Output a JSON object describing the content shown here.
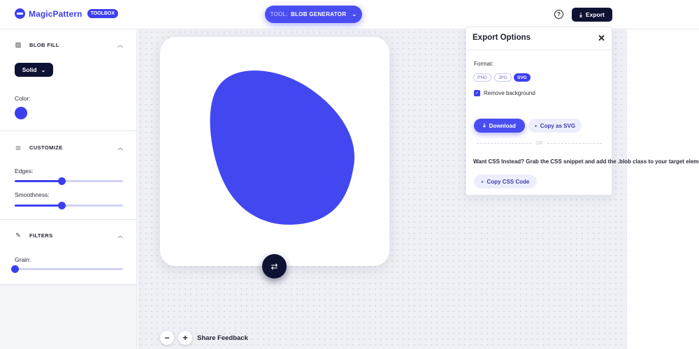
{
  "header": {
    "brand": "MagicPattern",
    "badge": "TOOLBOX",
    "tool_prefix": "TOOL:",
    "tool_name": "BLOB GENERATOR",
    "help_glyph": "?",
    "export_label": "Export"
  },
  "sidebar": {
    "blob_fill": {
      "title": "BLOB FILL",
      "fill_type": "Solid",
      "color_label": "Color:",
      "color": "#3c3ff0"
    },
    "customize": {
      "title": "CUSTOMIZE",
      "edges_label": "Edges:",
      "edges_value": 0.43,
      "smoothness_label": "Smoothness:",
      "smoothness_value": 0.43
    },
    "filters": {
      "title": "FILTERS",
      "grain_label": "Grain:",
      "grain_value": 0.0
    }
  },
  "canvas": {
    "blob_color": "#4347f0",
    "feedback_label": "Share Feedback",
    "zoom_out": "−",
    "zoom_in": "+"
  },
  "export_panel": {
    "title": "Export Options",
    "format_label": "Format:",
    "formats": [
      "PNG",
      "JPG",
      "SVG"
    ],
    "selected_format": "SVG",
    "remove_bg_label": "Remove background",
    "remove_bg_checked": true,
    "download_label": "Download",
    "copy_svg_label": "Copy as SVG",
    "or_label": "OR",
    "css_hint": "Want CSS Instead? Grab the CSS snippet and add the .blob class to your target element",
    "copy_css_label": "Copy CSS Code"
  },
  "colors": {
    "accent": "#3c3ff0",
    "dark": "#0e1233"
  }
}
